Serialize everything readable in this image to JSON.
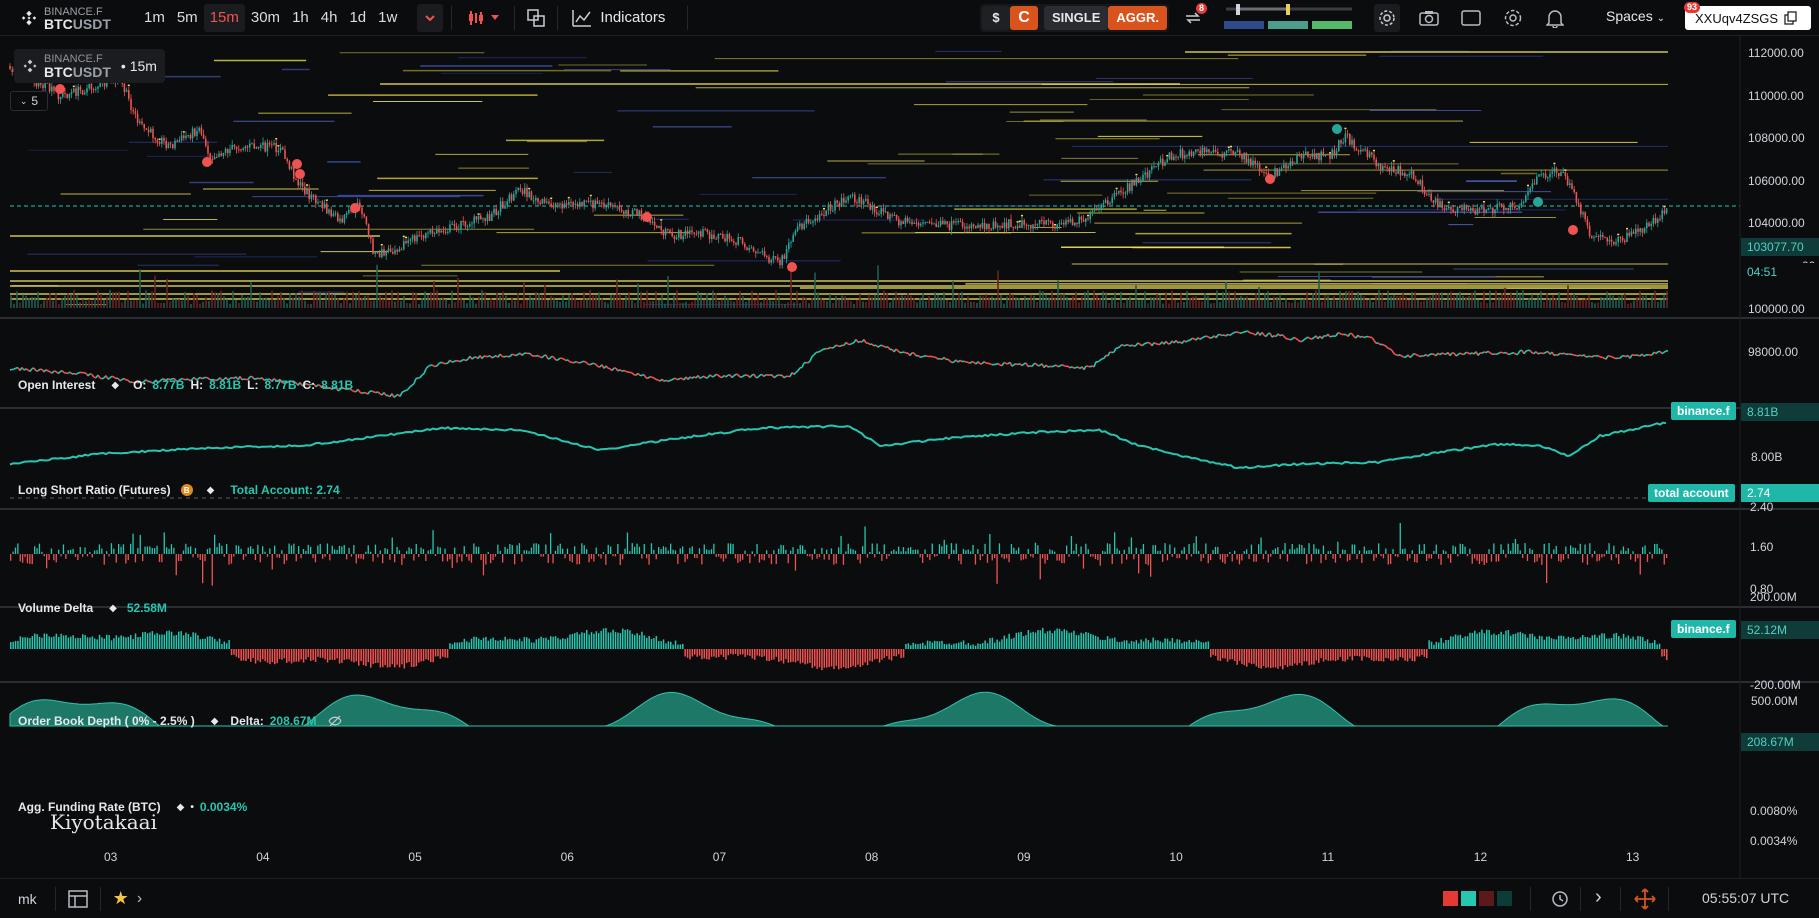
{
  "app": {
    "exchange": "BINANCE.F",
    "symbol_base": "BTC",
    "symbol_quote": "USDT"
  },
  "toolbar": {
    "timeframes": [
      "1m",
      "5m",
      "15m",
      "30m",
      "1h",
      "4h",
      "1d",
      "1w"
    ],
    "active_timeframe": "15m",
    "indicators_label": "Indicators",
    "mode_dollar": "$",
    "mode_c": "C",
    "mode_single": "SINGLE",
    "mode_aggr": "AGGR.",
    "sync_badge": "8",
    "spaces_label": "Spaces",
    "account_id": "XXUqv4ZSGS",
    "account_badge": "93"
  },
  "legend": {
    "exchange": "BINANCE.F",
    "symbol_base": "BTC",
    "symbol_quote": "USDT",
    "interval": "• 15m",
    "collapse_count": "5"
  },
  "price_axis": {
    "ticks": [
      "112000.00",
      "110000.00",
      "108000.00",
      "106000.00",
      "104000.00",
      "00",
      "100000.00",
      "98000.00"
    ],
    "last_price": "103077.70",
    "countdown": "04:51"
  },
  "time_axis": {
    "ticks": [
      "03",
      "04",
      "05",
      "06",
      "07",
      "08",
      "09",
      "10",
      "11",
      "12",
      "13"
    ]
  },
  "panes": {
    "open_interest": {
      "title": "Open Interest",
      "o_label": "O:",
      "o": "8.77B",
      "h_label": "H:",
      "h": "8.81B",
      "l_label": "L:",
      "l": "8.77B",
      "c_label": "C:",
      "c": "8.81B",
      "tag_name": "binance.f",
      "tag_value": "8.81B",
      "axis_tick": "8.00B"
    },
    "long_short": {
      "title": "Long Short Ratio (Futures)",
      "info_badge": "B",
      "value_label": "Total Account: 2.74",
      "tag_name": "total account",
      "tag_value": "2.74",
      "axis_ticks": [
        "2.40",
        "1.60",
        "0.80"
      ]
    },
    "volume_delta": {
      "title": "Volume Delta",
      "value": "52.58M",
      "tag_name": "binance.f",
      "tag_value": "52.12M",
      "axis_ticks": [
        "200.00M",
        "-200.00M"
      ]
    },
    "order_book": {
      "title": "Order Book Depth ( 0% - 2.5% )",
      "delta_label": "Delta:",
      "delta_value": "208.67M",
      "tag_value": "208.67M",
      "axis_tick": "500.00M"
    },
    "funding": {
      "title": "Agg. Funding Rate (BTC)",
      "value": "0.0034%",
      "axis_ticks": [
        "0.0080%",
        "0.0034%"
      ]
    }
  },
  "watermark": "Kiyotakaai",
  "bottom": {
    "user": "mk",
    "clock": "05:55:07 UTC",
    "swatches": [
      "#e53935",
      "#26c6b0",
      "#5a1a1c",
      "#0d3b36"
    ]
  },
  "colors": {
    "up": "#26a69a",
    "down": "#ef5350",
    "accent": "#d9541c",
    "teal": "#26c6b0"
  }
}
